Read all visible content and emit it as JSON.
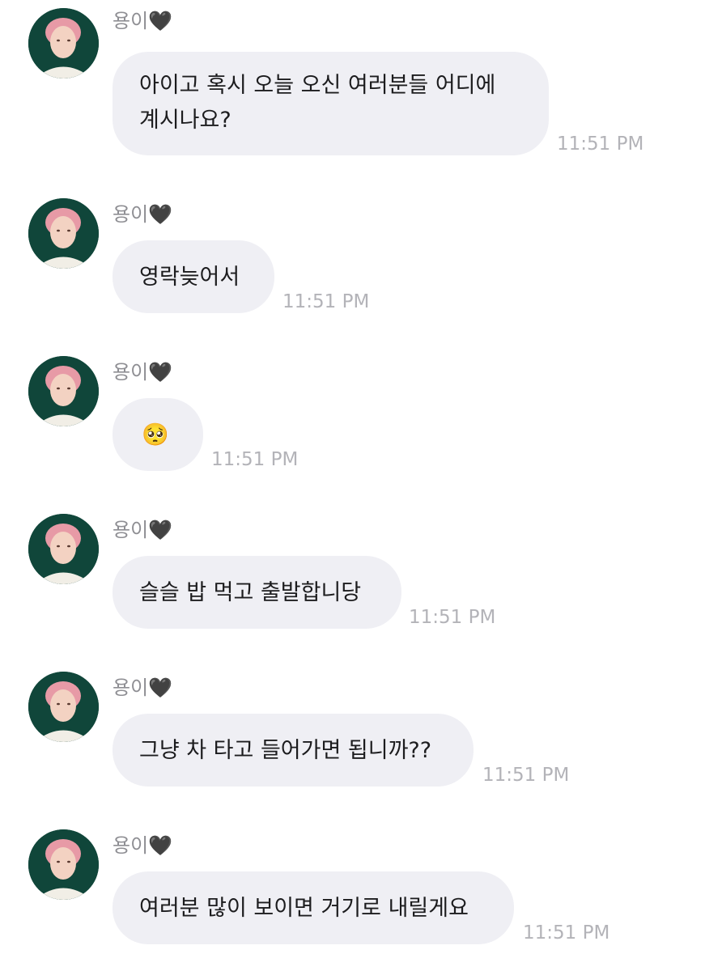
{
  "messages": [
    {
      "sender": "용이🖤",
      "text": "아이고 혹시 오늘 오신 여러분들 어디에\n계시나요?",
      "time": "11:51 PM"
    },
    {
      "sender": "용이🖤",
      "text": "영락늦어서",
      "time": "11:51 PM"
    },
    {
      "sender": "용이🖤",
      "text": "🥺",
      "time": "11:51 PM"
    },
    {
      "sender": "용이🖤",
      "text": "슬슬 밥 먹고 출발합니당",
      "time": "11:51 PM"
    },
    {
      "sender": "용이🖤",
      "text": "그냥 차 타고 들어가면 됩니까??",
      "time": "11:51 PM"
    },
    {
      "sender": "용이🖤",
      "text": "여러분 많이 보이면 거기로 내릴게요",
      "time": "11:51 PM"
    }
  ],
  "colors": {
    "bubble": "#efeff4",
    "timestamp": "#b3b3b8",
    "sender": "#8e8e93"
  }
}
